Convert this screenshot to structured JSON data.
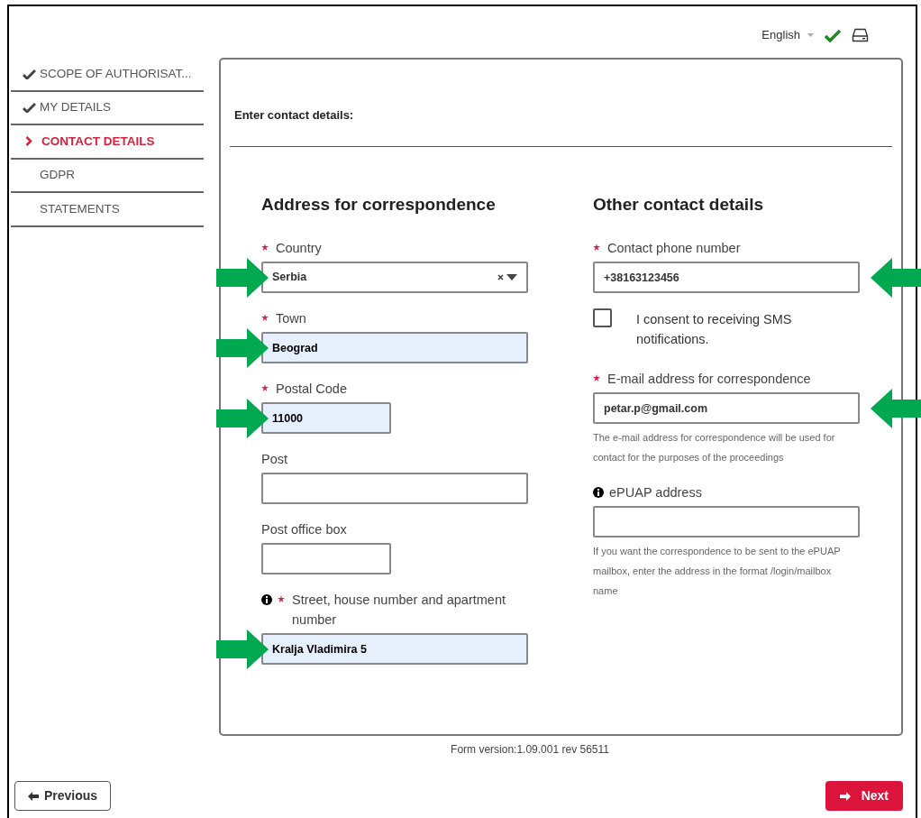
{
  "top_bar": {
    "language": "English",
    "saved": true
  },
  "steps": [
    {
      "label": "SCOPE OF AUTHORISAT...",
      "done": true,
      "selected": false
    },
    {
      "label": "MY DETAILS",
      "done": true,
      "selected": false
    },
    {
      "label": "CONTACT DETAILS",
      "done": false,
      "selected": true
    },
    {
      "label": "GDPR",
      "done": false,
      "selected": false
    },
    {
      "label": "STATEMENTS",
      "done": false,
      "selected": false
    }
  ],
  "form": {
    "title": "Enter contact details:",
    "left_column": {
      "heading": "Address for correspondence",
      "fields": [
        {
          "kind": "select",
          "label": "Country",
          "required": true,
          "info": false,
          "value": "Serbia",
          "autofilled": false,
          "marked": true
        },
        {
          "kind": "text",
          "label": "Town",
          "required": true,
          "info": false,
          "value": "Beograd",
          "autofilled": true,
          "marked": true
        },
        {
          "kind": "short_text",
          "label": "Postal Code",
          "required": true,
          "info": false,
          "value": "11000",
          "autofilled": true,
          "marked": true
        },
        {
          "kind": "text",
          "label": "Post",
          "required": false,
          "info": false,
          "autofilled": false,
          "marked": false
        },
        {
          "kind": "short_text",
          "label": "Post office box",
          "required": false,
          "info": false,
          "autofilled": false,
          "marked": false
        },
        {
          "kind": "text",
          "label": "Street, house number and apartment number",
          "required": true,
          "info": true,
          "value": "Kralja Vladimira 5",
          "autofilled": true,
          "marked": true
        }
      ]
    },
    "right_column": {
      "heading": "Other contact details",
      "fields": [
        {
          "kind": "text",
          "label": "Contact phone number",
          "required": true,
          "info": false,
          "value": "+38163123456",
          "autofilled": false,
          "marked": true
        },
        {
          "kind": "checkbox",
          "label": "I consent to receiving SMS notifications.",
          "checked": false
        },
        {
          "kind": "text",
          "label": "E-mail address for correspondence",
          "required": true,
          "info": false,
          "value": "petar.p@gmail.com",
          "autofilled": false,
          "marked": true,
          "hint": "The e-mail address for correspondence will be used for contact for the purposes of the proceedings"
        },
        {
          "kind": "text",
          "label": "ePUAP address",
          "required": false,
          "info": true,
          "autofilled": false,
          "marked": false,
          "hint": "If you want the correspondence to be sent to the ePUAP mailbox, enter the address in the format /login/mailbox name"
        }
      ]
    }
  },
  "form_version": "Form version:1.09.001 rev 56511",
  "buttons": {
    "previous": "Previous",
    "next": "Next"
  }
}
